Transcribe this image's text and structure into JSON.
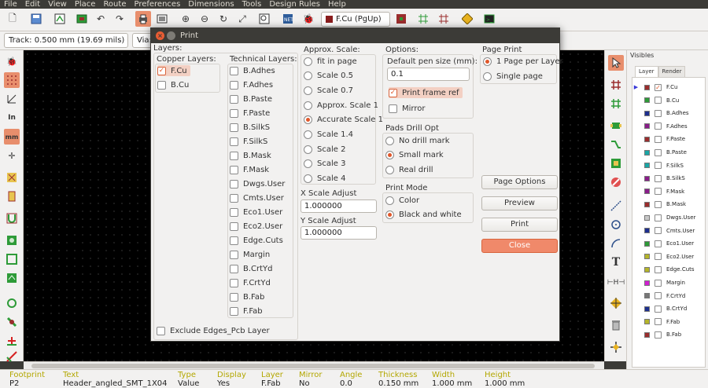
{
  "menubar": [
    "File",
    "Edit",
    "View",
    "Place",
    "Route",
    "Preferences",
    "Dimensions",
    "Tools",
    "Design Rules",
    "Help"
  ],
  "toolbar": {
    "layer_combo": "F.Cu (PgUp)"
  },
  "toolbar2": {
    "track": "Track: 0.500 mm (19.69 mils) *",
    "via": "Via:"
  },
  "colors": {
    "accent": "#e88e6c",
    "canvas": "#000000",
    "dark": "#3c3b37"
  },
  "left_icons": [
    "ladybug-icon",
    "grid-icon",
    "polar-coords-icon",
    "inches-icon",
    "millimeters-icon",
    "cursor-shape-icon",
    "ratsnest-icon",
    "module-ratsnest-icon",
    "microwave-icon",
    "show-zones-icon",
    "zone-outline-icon",
    "filled-zones-icon",
    "pad-sketch-icon",
    "via-sketch-icon",
    "track-sketch-icon",
    "high-contrast-icon"
  ],
  "right_icons": [
    "select-arrow-icon",
    "highlight-net-icon",
    "local-ratsnest-icon",
    "add-footprint-icon",
    "route-track-icon",
    "add-via-icon",
    "add-zone-icon",
    "keepout-icon",
    "add-line-icon",
    "add-circle-icon",
    "add-arc-icon",
    "add-text-icon",
    "dimension-icon",
    "target-icon",
    "delete-icon",
    "anchor-icon",
    "grid-origin-icon"
  ],
  "dialog": {
    "title": "Print",
    "layers_label": "Layers:",
    "copper_label": "Copper Layers:",
    "copper": [
      {
        "name": "F.Cu",
        "checked": true
      },
      {
        "name": "B.Cu",
        "checked": false
      }
    ],
    "technical_label": "Technical Layers:",
    "technical": [
      "B.Adhes",
      "F.Adhes",
      "B.Paste",
      "F.Paste",
      "B.SilkS",
      "F.SilkS",
      "B.Mask",
      "F.Mask",
      "Dwgs.User",
      "Cmts.User",
      "Eco1.User",
      "Eco2.User",
      "Edge.Cuts",
      "Margin",
      "B.CrtYd",
      "F.CrtYd",
      "B.Fab",
      "F.Fab"
    ],
    "exclude_edges": "Exclude Edges_Pcb Layer",
    "approx_scale_label": "Approx. Scale:",
    "scales": [
      {
        "label": "fit in page",
        "selected": false
      },
      {
        "label": "Scale 0.5",
        "selected": false
      },
      {
        "label": "Scale 0.7",
        "selected": false
      },
      {
        "label": "Approx. Scale 1",
        "selected": false
      },
      {
        "label": "Accurate Scale 1",
        "selected": true
      },
      {
        "label": "Scale 1.4",
        "selected": false
      },
      {
        "label": "Scale 2",
        "selected": false
      },
      {
        "label": "Scale 3",
        "selected": false
      },
      {
        "label": "Scale 4",
        "selected": false
      }
    ],
    "x_scale_label": "X Scale Adjust",
    "x_scale_value": "1.000000",
    "y_scale_label": "Y Scale Adjust",
    "y_scale_value": "1.000000",
    "options_label": "Options:",
    "pen_size_label": "Default pen size (mm):",
    "pen_size_value": "0.1",
    "print_frame_ref": "Print frame ref",
    "mirror": "Mirror",
    "pads_drill_label": "Pads Drill Opt",
    "drill_opts": [
      {
        "label": "No drill mark",
        "selected": false
      },
      {
        "label": "Small mark",
        "selected": true
      },
      {
        "label": "Real drill",
        "selected": false
      }
    ],
    "print_mode_label": "Print Mode",
    "print_modes": [
      {
        "label": "Color",
        "selected": false
      },
      {
        "label": "Black and white",
        "selected": true
      }
    ],
    "page_print_label": "Page Print",
    "page_print": [
      {
        "label": "1 Page per Layer",
        "selected": true
      },
      {
        "label": "Single page",
        "selected": false
      }
    ],
    "buttons": {
      "page_options": "Page Options",
      "preview": "Preview",
      "print": "Print",
      "close": "Close"
    }
  },
  "visibles": {
    "title": "Visibles",
    "tabs": [
      "Layer",
      "Render"
    ],
    "layers": [
      {
        "name": "F.Cu",
        "color": "#9b2d2d",
        "checked": true,
        "active": true
      },
      {
        "name": "B.Cu",
        "color": "#2e9b38",
        "checked": false
      },
      {
        "name": "B.Adhes",
        "color": "#1d2f8f",
        "checked": false
      },
      {
        "name": "F.Adhes",
        "color": "#8a1d8a",
        "checked": false
      },
      {
        "name": "F.Paste",
        "color": "#9b2d2d",
        "checked": false
      },
      {
        "name": "B.Paste",
        "color": "#1aa6a6",
        "checked": false
      },
      {
        "name": "F.SilkS",
        "color": "#1aa6a6",
        "checked": false
      },
      {
        "name": "B.SilkS",
        "color": "#8a1d8a",
        "checked": false
      },
      {
        "name": "F.Mask",
        "color": "#8a1d8a",
        "checked": false
      },
      {
        "name": "B.Mask",
        "color": "#9b2d2d",
        "checked": false
      },
      {
        "name": "Dwgs.User",
        "color": "#c8c8c8",
        "checked": false
      },
      {
        "name": "Cmts.User",
        "color": "#1d2f8f",
        "checked": false
      },
      {
        "name": "Eco1.User",
        "color": "#2e9b38",
        "checked": false
      },
      {
        "name": "Eco2.User",
        "color": "#b5b52a",
        "checked": false
      },
      {
        "name": "Edge.Cuts",
        "color": "#b5b52a",
        "checked": false
      },
      {
        "name": "Margin",
        "color": "#d21fd2",
        "checked": false
      },
      {
        "name": "F.CrtYd",
        "color": "#777777",
        "checked": false
      },
      {
        "name": "B.CrtYd",
        "color": "#1d2f8f",
        "checked": false
      },
      {
        "name": "F.Fab",
        "color": "#b5b52a",
        "checked": false
      },
      {
        "name": "B.Fab",
        "color": "#9b2d2d",
        "checked": false
      }
    ]
  },
  "status": [
    {
      "h": "Footprint",
      "v": "P2"
    },
    {
      "h": "Text",
      "v": "Header_angled_SMT_1X04"
    },
    {
      "h": "Type",
      "v": "Value"
    },
    {
      "h": "Display",
      "v": "Yes"
    },
    {
      "h": "Layer",
      "v": "F.Fab"
    },
    {
      "h": "Mirror",
      "v": "No"
    },
    {
      "h": "Angle",
      "v": "0.0"
    },
    {
      "h": "Thickness",
      "v": "0.150 mm"
    },
    {
      "h": "Width",
      "v": "1.000 mm"
    },
    {
      "h": "Height",
      "v": "1.000 mm"
    }
  ]
}
